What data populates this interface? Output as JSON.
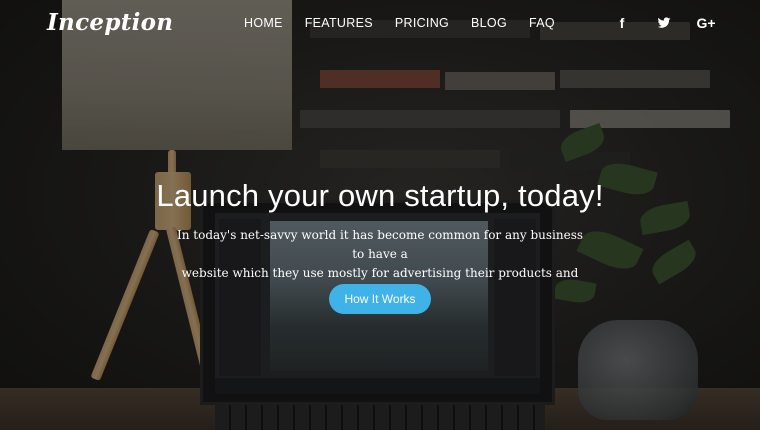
{
  "brand": {
    "logo_text": "Inception"
  },
  "nav": {
    "items": [
      {
        "label": "HOME"
      },
      {
        "label": "FEATURES"
      },
      {
        "label": "PRICING"
      },
      {
        "label": "BLOG"
      },
      {
        "label": "FAQ"
      }
    ]
  },
  "social": {
    "items": [
      {
        "icon": "facebook-icon",
        "glyph": "f"
      },
      {
        "icon": "twitter-icon"
      },
      {
        "icon": "google-plus-icon",
        "glyph": "G+"
      }
    ]
  },
  "hero": {
    "title": "Launch your own startup, today!",
    "text_line1": "In today's net-savvy world it has become common for any business to have a",
    "text_line2": "website which they use mostly for advertising their products and services.",
    "cta_label": "How It Works"
  },
  "theme": {
    "accent": "#3fb2e8",
    "overlay": "#0a0a0c"
  }
}
